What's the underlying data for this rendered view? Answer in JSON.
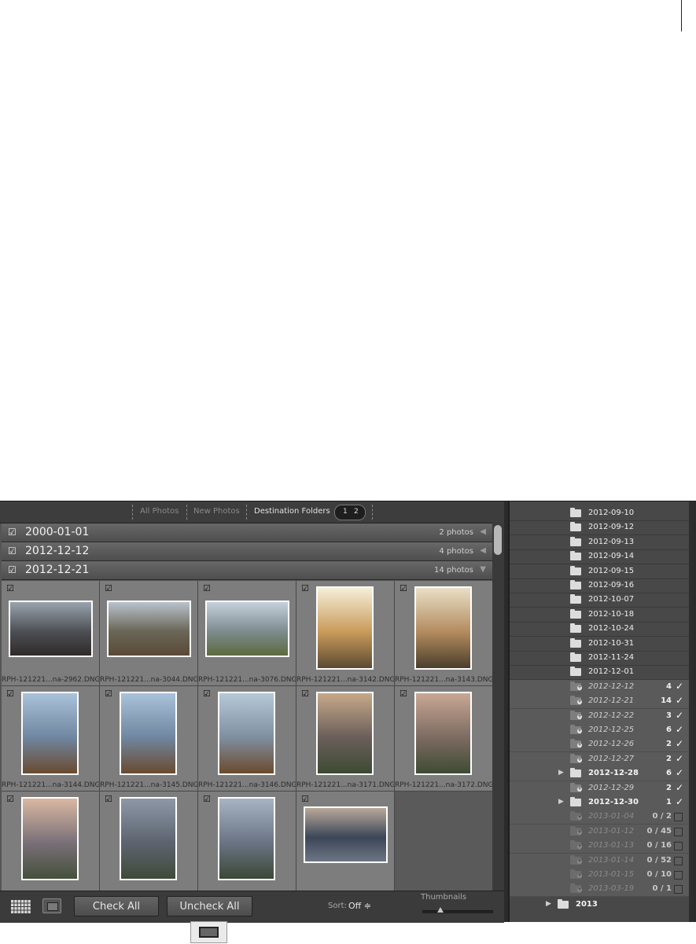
{
  "topbar": {
    "tabs": [
      "All Photos",
      "New Photos",
      "Destination Folders"
    ],
    "pages": [
      "1",
      "2"
    ]
  },
  "groups": [
    {
      "name": "2000-01-01",
      "count": "2 photos",
      "arrow": "◀"
    },
    {
      "name": "2012-12-12",
      "count": "4 photos",
      "arrow": "◀"
    },
    {
      "name": "2012-12-21",
      "count": "14 photos",
      "arrow": "▼"
    }
  ],
  "thumbnails": [
    {
      "file": "RPH-121221...na-2962.DNG",
      "orientation": "landscape",
      "checked": true
    },
    {
      "file": "RPH-121221...na-3044.DNG",
      "orientation": "landscape",
      "checked": true
    },
    {
      "file": "RPH-121221...na-3076.DNG",
      "orientation": "landscape",
      "checked": true
    },
    {
      "file": "RPH-121221...na-3142.DNG",
      "orientation": "portrait",
      "checked": true
    },
    {
      "file": "RPH-121221...na-3143.DNG",
      "orientation": "portrait",
      "checked": true
    },
    {
      "file": "RPH-121221...na-3144.DNG",
      "orientation": "portrait",
      "checked": true
    },
    {
      "file": "RPH-121221...na-3145.DNG",
      "orientation": "portrait",
      "checked": true
    },
    {
      "file": "RPH-121221...na-3146.DNG",
      "orientation": "portrait",
      "checked": true
    },
    {
      "file": "RPH-121221...na-3171.DNG",
      "orientation": "portrait",
      "checked": true
    },
    {
      "file": "RPH-121221...na-3172.DNG",
      "orientation": "portrait",
      "checked": true
    },
    {
      "file": "",
      "orientation": "portrait",
      "checked": true
    },
    {
      "file": "",
      "orientation": "portrait",
      "checked": true
    },
    {
      "file": "",
      "orientation": "portrait",
      "checked": true
    },
    {
      "file": "",
      "orientation": "landscape",
      "checked": true
    }
  ],
  "checkbox_glyph": "☑",
  "bottombar": {
    "check_all": "Check All",
    "uncheck_all": "Uncheck All",
    "sort_label": "Sort:",
    "sort_value": "Off ≑",
    "thumbnails_label": "Thumbnails",
    "thumbnail_size": 0.25
  },
  "folders": [
    {
      "name": "2012-09-10",
      "type": "existing"
    },
    {
      "name": "2012-09-12",
      "type": "existing"
    },
    {
      "name": "2012-09-13",
      "type": "existing"
    },
    {
      "name": "2012-09-14",
      "type": "existing"
    },
    {
      "name": "2012-09-15",
      "type": "existing"
    },
    {
      "name": "2012-09-16",
      "type": "existing"
    },
    {
      "name": "2012-10-07",
      "type": "existing"
    },
    {
      "name": "2012-10-18",
      "type": "existing"
    },
    {
      "name": "2012-10-24",
      "type": "existing"
    },
    {
      "name": "2012-10-31",
      "type": "existing"
    },
    {
      "name": "2012-11-24",
      "type": "existing"
    },
    {
      "name": "2012-12-01",
      "type": "existing"
    },
    {
      "name": "2012-12-12",
      "type": "new",
      "count": "4",
      "checked": true
    },
    {
      "name": "2012-12-21",
      "type": "new",
      "count": "14",
      "checked": true
    },
    {
      "name": "2012-12-22",
      "type": "new",
      "count": "3",
      "checked": true
    },
    {
      "name": "2012-12-25",
      "type": "new",
      "count": "6",
      "checked": true
    },
    {
      "name": "2012-12-26",
      "type": "new",
      "count": "2",
      "checked": true
    },
    {
      "name": "2012-12-27",
      "type": "new",
      "count": "2",
      "checked": true
    },
    {
      "name": "2012-12-28",
      "type": "existing-import",
      "count": "6",
      "checked": true,
      "expandable": true
    },
    {
      "name": "2012-12-29",
      "type": "new",
      "count": "2",
      "checked": true
    },
    {
      "name": "2012-12-30",
      "type": "existing-import",
      "count": "1",
      "checked": true,
      "expandable": true
    },
    {
      "name": "2013-01-04",
      "type": "dim",
      "count": "0 / 2",
      "checked": false
    },
    {
      "name": "2013-01-12",
      "type": "dim",
      "count": "0 / 45",
      "checked": false
    },
    {
      "name": "2013-01-13",
      "type": "dim",
      "count": "0 / 16",
      "checked": false
    },
    {
      "name": "2013-01-14",
      "type": "dim",
      "count": "0 / 52",
      "checked": false
    },
    {
      "name": "2013-01-15",
      "type": "dim",
      "count": "0 / 10",
      "checked": false
    },
    {
      "name": "2013-03-19",
      "type": "dim",
      "count": "0 / 1",
      "checked": false
    }
  ],
  "year_folder": {
    "name": "2013",
    "arrow": "▶"
  },
  "glyphs": {
    "check": "✓",
    "expand": "▶",
    "plus": "+"
  },
  "colors": {
    "panel": "#555555",
    "cell": "#7d7d7d",
    "sidebar": "#484848",
    "highlight": "#5a5a5a"
  }
}
